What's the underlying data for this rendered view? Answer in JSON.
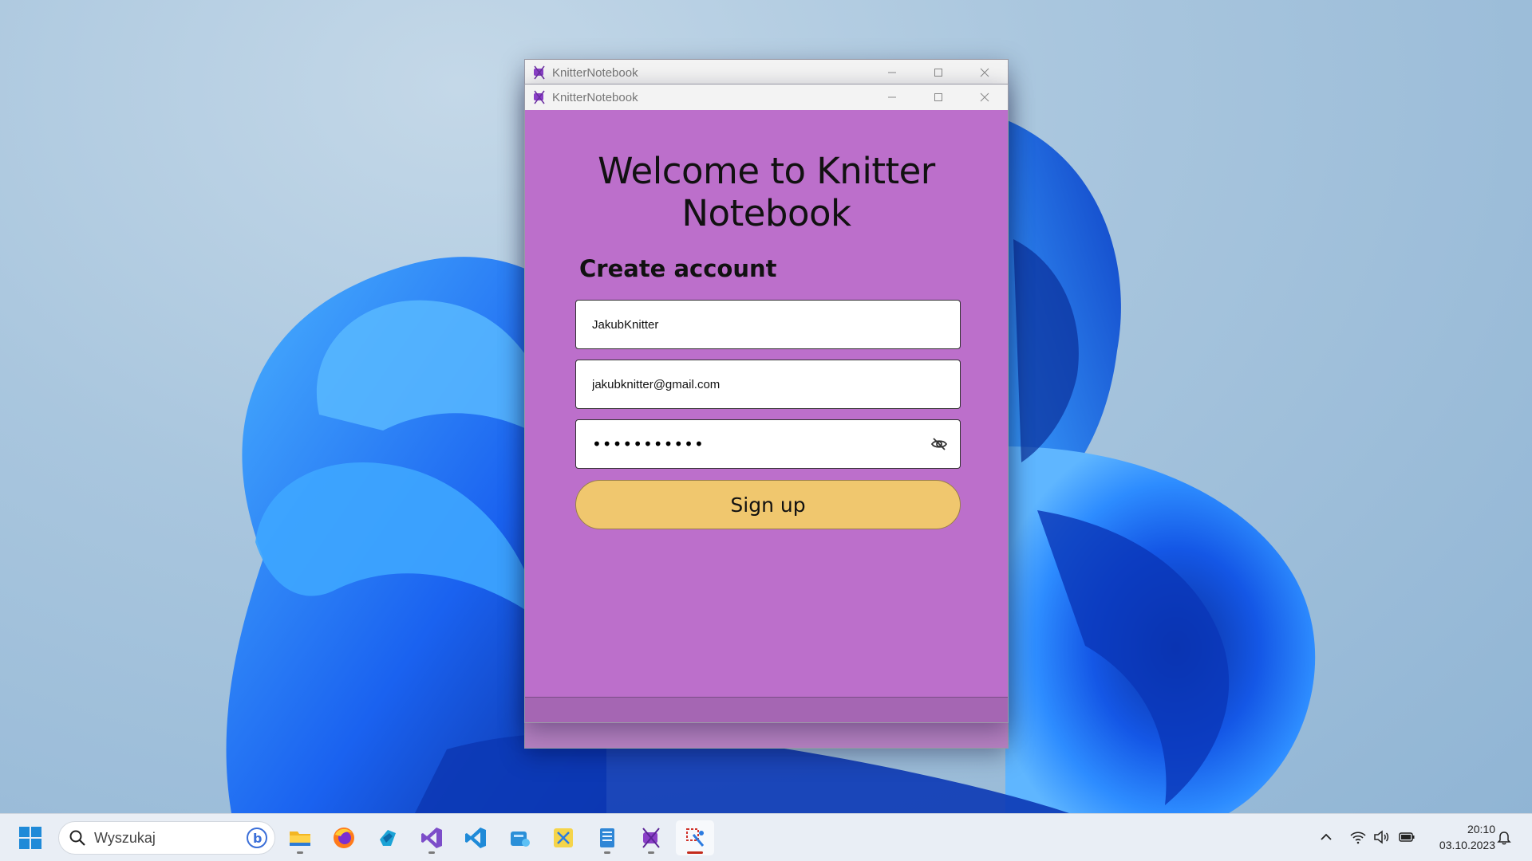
{
  "app": {
    "window_title": "KnitterNotebook"
  },
  "form": {
    "welcome_heading": "Welcome to Knitter Notebook",
    "section_heading": "Create account",
    "username_value": "JakubKnitter",
    "email_value": "jakubknitter@gmail.com",
    "password_masked": "•••••••••••",
    "signup_label": "Sign up"
  },
  "taskbar": {
    "search_label": "Wyszukaj",
    "apps": [
      "file-explorer",
      "firefox",
      "azure-data-studio",
      "visual-studio",
      "vs-code",
      "azure-storage-explorer",
      "snipping-tool",
      "notepad",
      "knitter-notebook",
      "debugger"
    ],
    "active_app": "debugger"
  },
  "tray": {
    "time": "20:10",
    "date": "03.10.2023"
  },
  "colors": {
    "window_purple": "#bc6fcb",
    "signup_yellow": "#f0c76e",
    "wallpaper_blue": "#1e6bff"
  }
}
